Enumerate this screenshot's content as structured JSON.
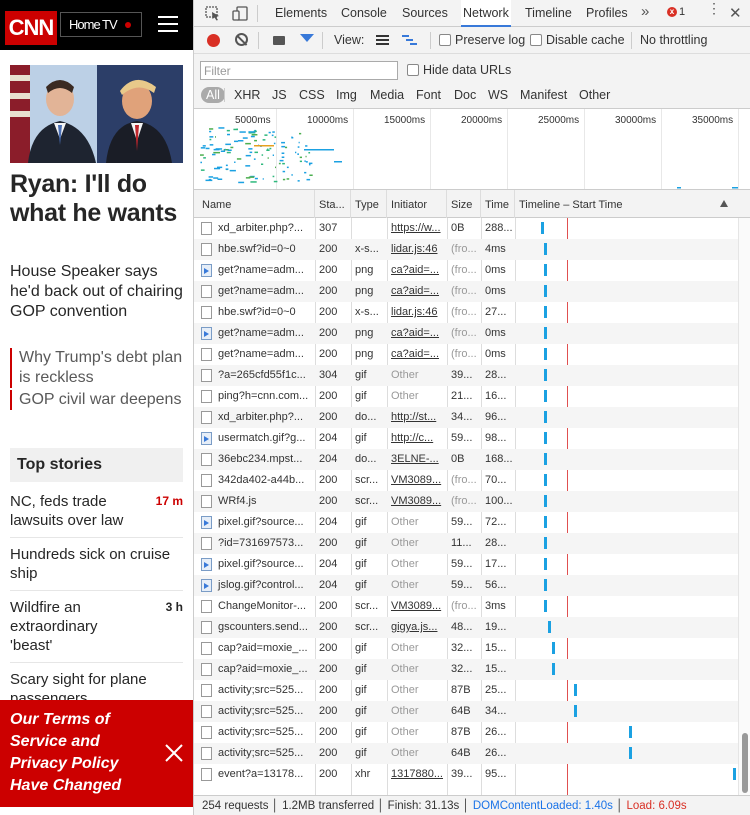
{
  "cnn": {
    "logo": "CNN",
    "edition": "Home TV",
    "headline": "Ryan: I'll do what he wants",
    "summary": "House Speaker says he'd back out of chairing GOP convention",
    "related": [
      "Why Trump's debt plan is reckless",
      "GOP civil war deepens"
    ],
    "top_stories_title": "Top stories",
    "stories": [
      {
        "title": "NC, feds trade lawsuits over law",
        "age": "17 m",
        "age_color": "#cc0000"
      },
      {
        "title": "Hundreds sick on cruise ship",
        "age": ""
      },
      {
        "title": "Wildfire an extraordinary 'beast'",
        "age": "3 h"
      },
      {
        "title": "Scary sight for plane passengers",
        "age": ""
      }
    ],
    "banner": "Our Terms of Service and Privacy Policy Have Changed",
    "colors": {
      "brand": "#cc0000"
    }
  },
  "devtools": {
    "tabs": [
      "Elements",
      "Console",
      "Sources",
      "Network",
      "Timeline",
      "Profiles"
    ],
    "active_tab": "Network",
    "overflow": "»",
    "error_count": "1",
    "toolbar": {
      "view_label": "View:",
      "preserve_log": "Preserve log",
      "disable_cache": "Disable cache",
      "throttling": "No throttling"
    },
    "filter": {
      "placeholder": "Filter",
      "hide_data_urls": "Hide data URLs",
      "types": [
        "All",
        "XHR",
        "JS",
        "CSS",
        "Img",
        "Media",
        "Font",
        "Doc",
        "WS",
        "Manifest",
        "Other"
      ]
    },
    "overview_ticks": [
      "5000ms",
      "10000ms",
      "15000ms",
      "20000ms",
      "25000ms",
      "30000ms",
      "35000ms"
    ],
    "columns": [
      "Name",
      "Sta...",
      "Type",
      "Initiator",
      "Size",
      "Time",
      "Timeline – Start Time"
    ],
    "requests": [
      {
        "name": "xd_arbiter.php?...",
        "status": "307",
        "type": "",
        "initiator": "https://w...",
        "size": "0B",
        "time": "288...",
        "icon": "doc",
        "bar": 0.12
      },
      {
        "name": "hbe.swf?id=0~0",
        "status": "200",
        "type": "x-s...",
        "initiator": "lidar.js:46",
        "size": "(fro...",
        "time": "4ms",
        "icon": "doc",
        "bar": 0.13
      },
      {
        "name": "get?name=adm...",
        "status": "200",
        "type": "png",
        "initiator": "ca?aid=...",
        "size": "(fro...",
        "time": "0ms",
        "icon": "img",
        "bar": 0.13
      },
      {
        "name": "get?name=adm...",
        "status": "200",
        "type": "png",
        "initiator": "ca?aid=...",
        "size": "(fro...",
        "time": "0ms",
        "icon": "doc",
        "bar": 0.13
      },
      {
        "name": "hbe.swf?id=0~0",
        "status": "200",
        "type": "x-s...",
        "initiator": "lidar.js:46",
        "size": "(fro...",
        "time": "27...",
        "icon": "doc",
        "bar": 0.13
      },
      {
        "name": "get?name=adm...",
        "status": "200",
        "type": "png",
        "initiator": "ca?aid=...",
        "size": "(fro...",
        "time": "0ms",
        "icon": "img",
        "bar": 0.13
      },
      {
        "name": "get?name=adm...",
        "status": "200",
        "type": "png",
        "initiator": "ca?aid=...",
        "size": "(fro...",
        "time": "0ms",
        "icon": "doc",
        "bar": 0.13
      },
      {
        "name": "?a=265cfd55f1c...",
        "status": "304",
        "type": "gif",
        "initiator": "Other",
        "size": "39...",
        "time": "28...",
        "icon": "doc",
        "bar": 0.13
      },
      {
        "name": "ping?h=cnn.com...",
        "status": "200",
        "type": "gif",
        "initiator": "Other",
        "size": "21...",
        "time": "16...",
        "icon": "doc",
        "bar": 0.13
      },
      {
        "name": "xd_arbiter.php?...",
        "status": "200",
        "type": "do...",
        "initiator": "http://st...",
        "size": "34...",
        "time": "96...",
        "icon": "doc",
        "bar": 0.13
      },
      {
        "name": "usermatch.gif?g...",
        "status": "204",
        "type": "gif",
        "initiator": "http://c...",
        "size": "59...",
        "time": "98...",
        "icon": "img",
        "bar": 0.13
      },
      {
        "name": "36ebc234.mpst...",
        "status": "204",
        "type": "do...",
        "initiator": "3ELNE-...",
        "size": "0B",
        "time": "168...",
        "icon": "doc",
        "bar": 0.13
      },
      {
        "name": "342da402-a44b...",
        "status": "200",
        "type": "scr...",
        "initiator": "VM3089...",
        "size": "(fro...",
        "time": "70...",
        "icon": "doc",
        "bar": 0.13
      },
      {
        "name": "WRf4.js",
        "status": "200",
        "type": "scr...",
        "initiator": "VM3089...",
        "size": "(fro...",
        "time": "100...",
        "icon": "doc",
        "bar": 0.13
      },
      {
        "name": "pixel.gif?source...",
        "status": "204",
        "type": "gif",
        "initiator": "Other",
        "size": "59...",
        "time": "72...",
        "icon": "img",
        "bar": 0.13
      },
      {
        "name": "?id=731697573...",
        "status": "200",
        "type": "gif",
        "initiator": "Other",
        "size": "11...",
        "time": "28...",
        "icon": "doc",
        "bar": 0.13
      },
      {
        "name": "pixel.gif?source...",
        "status": "204",
        "type": "gif",
        "initiator": "Other",
        "size": "59...",
        "time": "17...",
        "icon": "img",
        "bar": 0.13
      },
      {
        "name": "jslog.gif?control...",
        "status": "204",
        "type": "gif",
        "initiator": "Other",
        "size": "59...",
        "time": "56...",
        "icon": "img",
        "bar": 0.13
      },
      {
        "name": "ChangeMonitor-...",
        "status": "200",
        "type": "scr...",
        "initiator": "VM3089...",
        "size": "(fro...",
        "time": "3ms",
        "icon": "doc",
        "bar": 0.13
      },
      {
        "name": "gscounters.send...",
        "status": "200",
        "type": "scr...",
        "initiator": "gigya.js...",
        "size": "48...",
        "time": "19...",
        "icon": "doc",
        "bar": 0.15
      },
      {
        "name": "cap?aid=moxie_...",
        "status": "200",
        "type": "gif",
        "initiator": "Other",
        "size": "32...",
        "time": "15...",
        "icon": "doc",
        "bar": 0.17
      },
      {
        "name": "cap?aid=moxie_...",
        "status": "200",
        "type": "gif",
        "initiator": "Other",
        "size": "32...",
        "time": "15...",
        "icon": "doc",
        "bar": 0.17
      },
      {
        "name": "activity;src=525...",
        "status": "200",
        "type": "gif",
        "initiator": "Other",
        "size": "87B",
        "time": "25...",
        "icon": "doc",
        "bar": 0.27
      },
      {
        "name": "activity;src=525...",
        "status": "200",
        "type": "gif",
        "initiator": "Other",
        "size": "64B",
        "time": "34...",
        "icon": "doc",
        "bar": 0.27
      },
      {
        "name": "activity;src=525...",
        "status": "200",
        "type": "gif",
        "initiator": "Other",
        "size": "87B",
        "time": "26...",
        "icon": "doc",
        "bar": 0.52
      },
      {
        "name": "activity;src=525...",
        "status": "200",
        "type": "gif",
        "initiator": "Other",
        "size": "64B",
        "time": "26...",
        "icon": "doc",
        "bar": 0.52
      },
      {
        "name": "event?a=13178...",
        "status": "200",
        "type": "xhr",
        "initiator": "1317880...",
        "size": "39...",
        "time": "95...",
        "icon": "doc",
        "bar": 0.99
      }
    ],
    "status_bar": {
      "summary": "254 requests │ 1.2MB transferred │ Finish: 31.13s │",
      "dom_loaded": "DOMContentLoaded: 1.40s",
      "sep": "│",
      "load": "Load: 6.09s"
    },
    "colors": {
      "accent": "#3879d9",
      "waterfall": "#1ba1e2",
      "load_line": "#e05050"
    }
  }
}
